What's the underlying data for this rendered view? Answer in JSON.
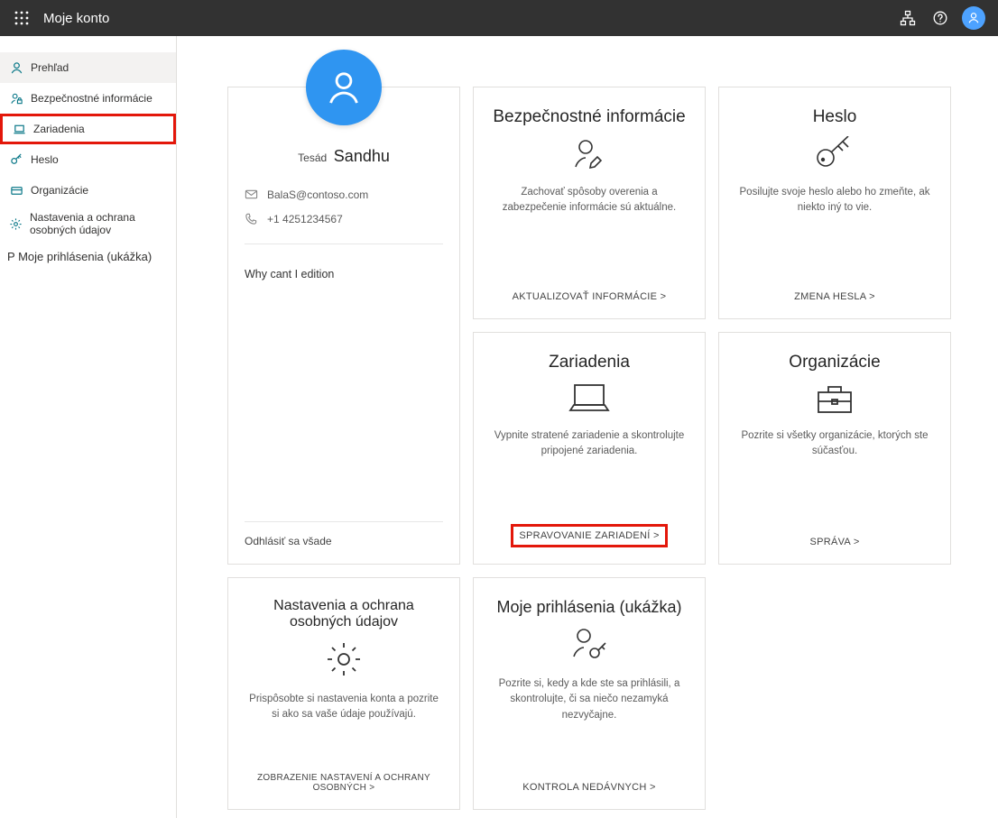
{
  "header": {
    "title": "Moje konto"
  },
  "sidebar": {
    "items": [
      {
        "label": "Prehľad"
      },
      {
        "label": "Bezpečnostné informácie"
      },
      {
        "label": "Zariadenia"
      },
      {
        "label": "Heslo"
      },
      {
        "label": "Organizácie"
      },
      {
        "label": "Nastavenia a ochrana osobných údajov"
      },
      {
        "label": "Moje prihlásenia (ukážka)"
      }
    ]
  },
  "profile": {
    "first_name": "Tesád",
    "last_name": "Sandhu",
    "email": "BalaS@contoso.com",
    "phone": "+1 4251234567",
    "note": "Why cant I edition",
    "signout": "Odhlásiť sa všade"
  },
  "cards": {
    "security": {
      "title": "Bezpečnostné informácie",
      "desc": "Zachovať spôsoby overenia a zabezpečenie informácie sú aktuálne.",
      "action": "AKTUALIZOVAŤ INFORMÁCIE &gt;"
    },
    "password": {
      "title": "Heslo",
      "desc": "Posilujte svoje heslo alebo ho zmeňte, ak niekto iný to vie.",
      "action": "ZMENA HESLA &gt;"
    },
    "devices": {
      "title": "Zariadenia",
      "desc": "Vypnite stratené zariadenie a skontrolujte pripojené zariadenia.",
      "action": "SPRAVOVANIE ZARIADENÍ &gt;"
    },
    "orgs": {
      "title": "Organizácie",
      "desc": "Pozrite si všetky organizácie, ktorých ste súčasťou.",
      "action": "SPRÁVA &gt;"
    },
    "settings": {
      "title": "Nastavenia a ochrana osobných údajov",
      "desc": "Prispôsobte si nastavenia konta a pozrite si ako sa vaše údaje používajú.",
      "action": "ZOBRAZENIE NASTAVENÍ A OCHRANY OSOBNÝCH &gt;"
    },
    "signins": {
      "title": "Moje prihlásenia (ukážka)",
      "desc": "Pozrite si, kedy a kde ste sa prihlásili, a skontrolujte, či sa niečo nezamyká nezvyčajne.",
      "action": "KONTROLA NEDÁVNYCH &gt;"
    }
  }
}
